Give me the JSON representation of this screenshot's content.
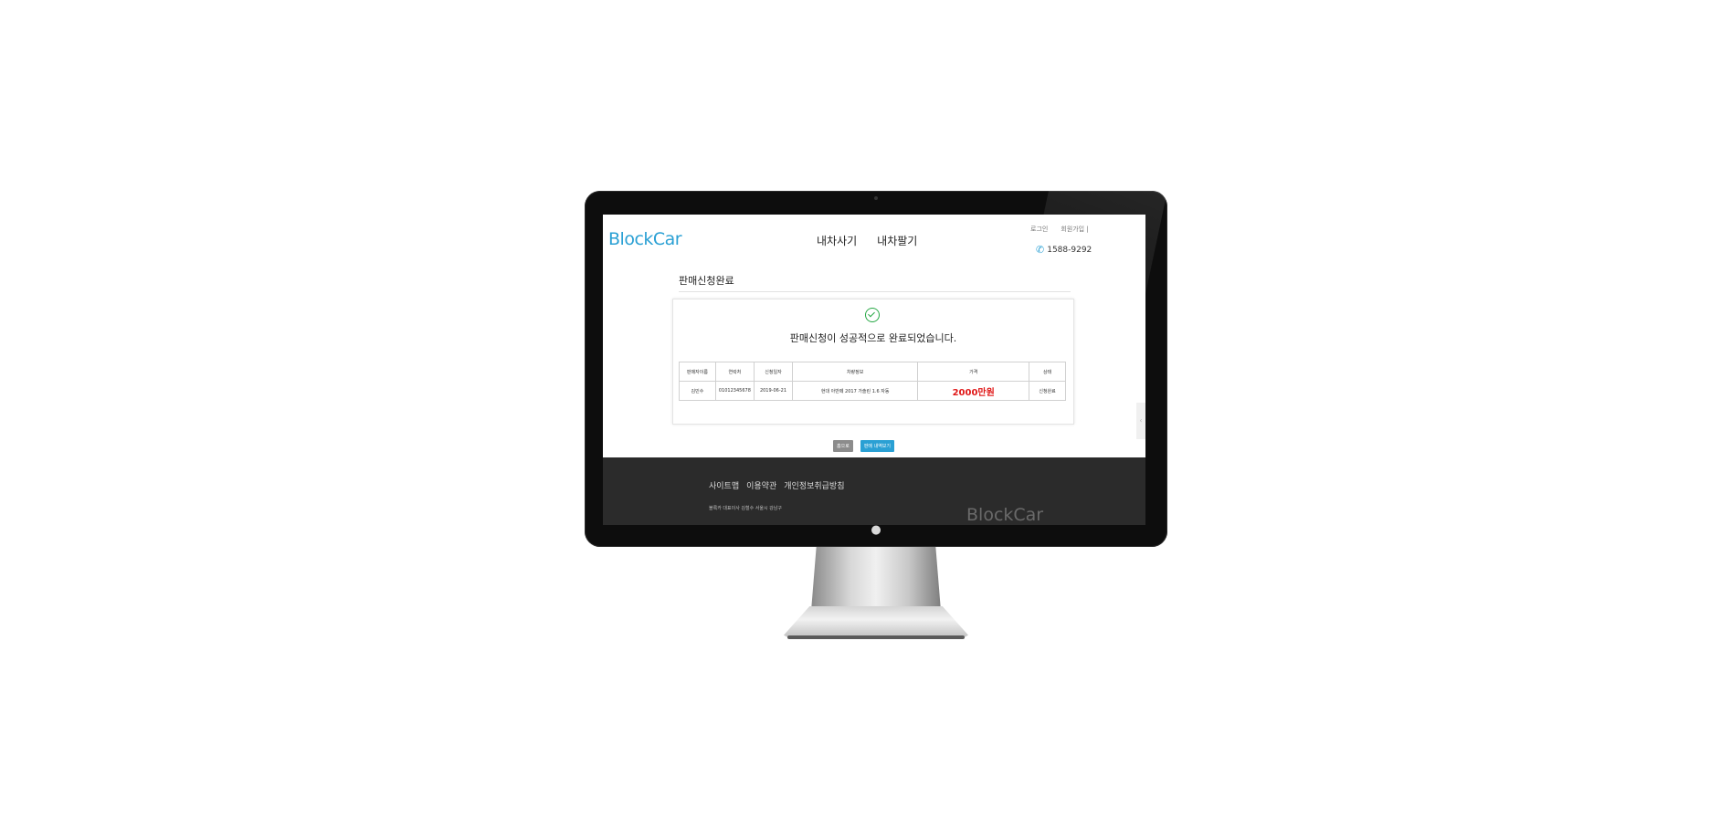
{
  "site": {
    "logo": "BlockCar",
    "nav": [
      "내차사기",
      "내차팔기"
    ],
    "util_links": [
      "로그인",
      "회원가입 |"
    ],
    "phone": "1588-9292",
    "accent_color": "#2aa0d4"
  },
  "page": {
    "title": "판매신청완료",
    "icon": "check-circle-icon",
    "message": "판매신청이 성공적으로 완료되었습니다."
  },
  "table": {
    "headers": [
      "판매자이름",
      "연락처",
      "신청일자",
      "차량정보",
      "가격",
      "상태"
    ],
    "row": [
      "김민수",
      "01012345678",
      "2019-06-21",
      "현대 아반떼 2017 가솔린 1.6 자동",
      "2000만원",
      "신청완료"
    ],
    "price_color": "#e01818"
  },
  "buttons": {
    "home": "홈으로",
    "sell_more": "판매 내역보기"
  },
  "footer": {
    "links": [
      "사이트맵",
      "이용약관",
      "개인정보취급방침"
    ],
    "address": "블록카 대표이사 김철수 서울시 강남구",
    "logo": "BlockCar"
  }
}
